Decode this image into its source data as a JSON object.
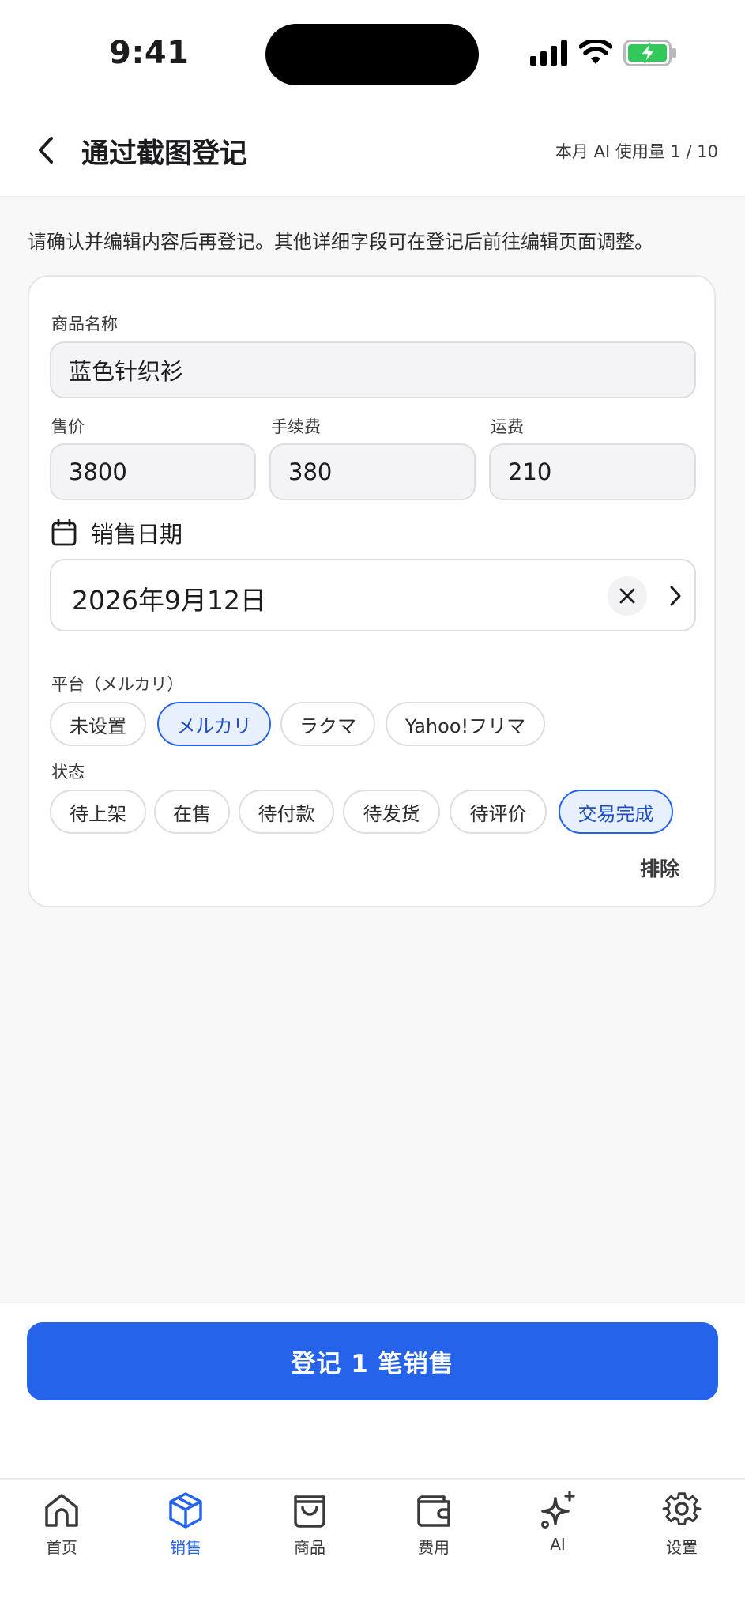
{
  "status_bar": {
    "time": "9:41"
  },
  "header": {
    "title": "通过截图登记",
    "usage": "本月 AI 使用量 1 / 10"
  },
  "hint": "请确认并编辑内容后再登记。其他详细字段可在登记后前往编辑页面调整。",
  "form": {
    "product_name_label": "商品名称",
    "product_name_value": "蓝色针织衫",
    "price_label": "售价",
    "price_value": "3800",
    "fee_label": "手续费",
    "fee_value": "380",
    "shipping_label": "运费",
    "shipping_value": "210",
    "date_label": "销售日期",
    "date_value": "2026年9月12日",
    "platform_label": "平台（メルカリ）",
    "platforms": [
      "未设置",
      "メルカリ",
      "ラクマ",
      "Yahoo!フリマ"
    ],
    "platform_selected": "メルカリ",
    "status_label": "状态",
    "statuses": [
      "待上架",
      "在售",
      "待付款",
      "待发货",
      "待评价",
      "交易完成"
    ],
    "status_selected": "交易完成",
    "exclude_label": "排除"
  },
  "submit_label": "登记 1 笔销售",
  "tabs": [
    {
      "label": "首页",
      "icon": "home-icon"
    },
    {
      "label": "销售",
      "icon": "box-icon",
      "active": true
    },
    {
      "label": "商品",
      "icon": "shopping-bag-icon"
    },
    {
      "label": "费用",
      "icon": "wallet-icon"
    },
    {
      "label": "AI",
      "icon": "sparkles-icon"
    },
    {
      "label": "设置",
      "icon": "gear-icon"
    }
  ],
  "colors": {
    "accent": "#2563eb",
    "accent_light": "#e8f0fd",
    "battery": "#34c759"
  }
}
